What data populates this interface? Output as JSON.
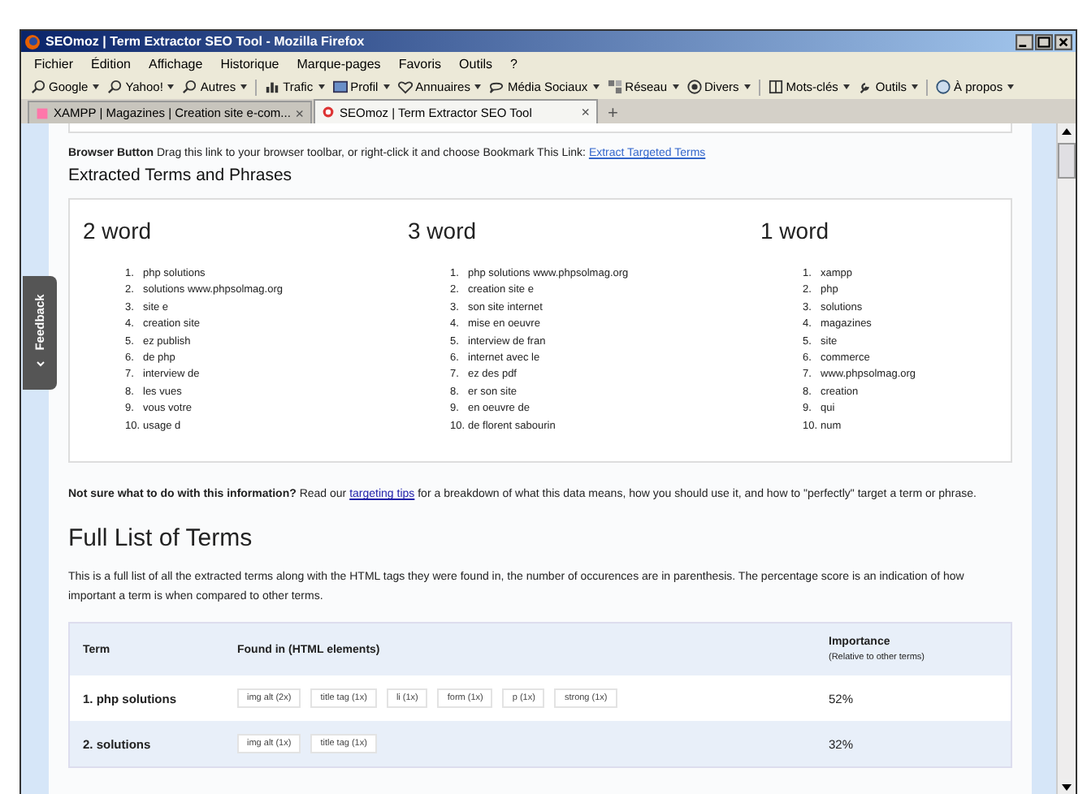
{
  "window": {
    "title": "SEOmoz | Term Extractor SEO Tool - Mozilla Firefox"
  },
  "menu": [
    "Fichier",
    "Édition",
    "Affichage",
    "Historique",
    "Marque-pages",
    "Favoris",
    "Outils",
    "?"
  ],
  "toolbar": [
    {
      "label": "Google",
      "kind": "search"
    },
    {
      "label": "Yahoo!",
      "kind": "search"
    },
    {
      "label": "Autres",
      "kind": "search"
    },
    {
      "label": "Trafic",
      "kind": "chart"
    },
    {
      "label": "Profil",
      "kind": "card"
    },
    {
      "label": "Annuaires",
      "kind": "heart"
    },
    {
      "label": "Média Sociaux",
      "kind": "bubble"
    },
    {
      "label": "Réseau",
      "kind": "network"
    },
    {
      "label": "Divers",
      "kind": "target"
    },
    {
      "label": "Mots-clés",
      "kind": "book"
    },
    {
      "label": "Outils",
      "kind": "tool"
    },
    {
      "label": "À propos",
      "kind": "info"
    }
  ],
  "tabs": [
    {
      "label": "XAMPP | Magazines | Creation site e-com...",
      "selected": false,
      "close": "×"
    },
    {
      "label": "SEOmoz | Term Extractor SEO Tool",
      "selected": true,
      "close": "×"
    }
  ],
  "new_tab": "+",
  "feedback": "Feedback",
  "bookmarklet": {
    "label": "Browser Button",
    "text": "Drag this link to your browser toolbar, or right-click it and choose Bookmark This Link:",
    "link": "Extract Targeted Terms"
  },
  "extracted_heading": "Extracted Terms and Phrases",
  "columns": [
    {
      "title": "2 word",
      "terms": [
        {
          "number": "1.",
          "text": "php solutions"
        },
        {
          "number": "2.",
          "text": "solutions www.phpsolmag.org"
        },
        {
          "number": "3.",
          "text": "site e"
        },
        {
          "number": "4.",
          "text": "creation site"
        },
        {
          "number": "5.",
          "text": "ez publish"
        },
        {
          "number": "6.",
          "text": "de php"
        },
        {
          "number": "7.",
          "text": "interview de"
        },
        {
          "number": "8.",
          "text": "les vues"
        },
        {
          "number": "9.",
          "text": "vous votre"
        },
        {
          "number": "10.",
          "text": "usage d"
        }
      ]
    },
    {
      "title": "3 word",
      "terms": [
        {
          "number": "1.",
          "text": "php solutions www.phpsolmag.org"
        },
        {
          "number": "2.",
          "text": "creation site e"
        },
        {
          "number": "3.",
          "text": "son site internet"
        },
        {
          "number": "4.",
          "text": "mise en oeuvre"
        },
        {
          "number": "5.",
          "text": "interview de fran"
        },
        {
          "number": "6.",
          "text": "internet avec le"
        },
        {
          "number": "7.",
          "text": "ez des pdf"
        },
        {
          "number": "8.",
          "text": "er son site"
        },
        {
          "number": "9.",
          "text": "en oeuvre de"
        },
        {
          "number": "10.",
          "text": "de florent sabourin"
        }
      ]
    },
    {
      "title": "1 word",
      "terms": [
        {
          "number": "1.",
          "text": "xampp"
        },
        {
          "number": "2.",
          "text": "php"
        },
        {
          "number": "3.",
          "text": "solutions"
        },
        {
          "number": "4.",
          "text": "magazines"
        },
        {
          "number": "5.",
          "text": "site"
        },
        {
          "number": "6.",
          "text": "commerce"
        },
        {
          "number": "7.",
          "text": "www.phpsolmag.org"
        },
        {
          "number": "8.",
          "text": "creation"
        },
        {
          "number": "9.",
          "text": "qui"
        },
        {
          "number": "10.",
          "text": "num"
        }
      ]
    }
  ],
  "note": {
    "bold": "Not sure what to do with this information?",
    "before": "Read our",
    "link": "targeting tips",
    "after": "for a breakdown of what this data means, how you should use it, and how to \"perfectly\" target a term or phrase."
  },
  "full_heading": "Full List of Terms",
  "description": "This is a full list of all the extracted terms along with the HTML tags they were found in, the number of occurences are in parenthesis. The percentage score is an indication of how important a term is when compared to other terms.",
  "table": {
    "columns": [
      "Term",
      "Found in (HTML elements)",
      "Importance"
    ],
    "importance_note": "(Relative to other terms)",
    "rows": [
      {
        "term": "1. php solutions",
        "tags": [
          "img alt (2x)",
          "title tag (1x)",
          "li (1x)",
          "form (1x)",
          "p (1x)",
          "strong (1x)"
        ],
        "importance": "52%"
      },
      {
        "term": "2. solutions",
        "tags": [
          "img alt (1x)",
          "title tag (1x)"
        ],
        "importance": "32%"
      }
    ]
  }
}
